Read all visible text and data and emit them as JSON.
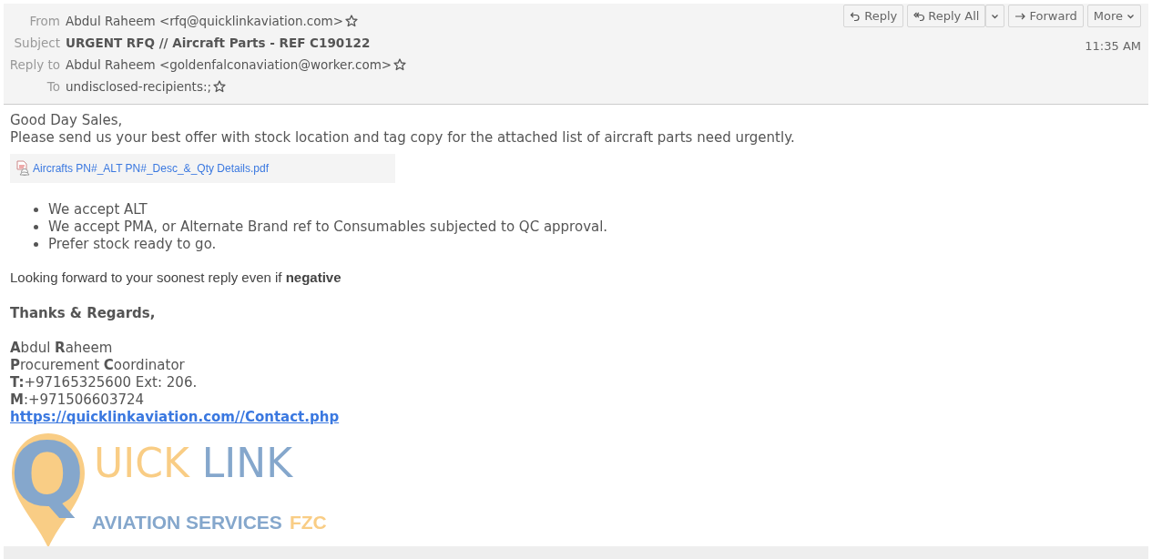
{
  "header": {
    "fields": [
      {
        "label": "From",
        "value": "Abdul Raheem <rfq@quicklinkaviation.com>",
        "kind": "address",
        "starred": false
      },
      {
        "label": "Subject",
        "value": "URGENT RFQ // Aircraft Parts - REF C190122",
        "kind": "subject"
      },
      {
        "label": "Reply to",
        "value": "Abdul Raheem <goldenfalconaviation@worker.com>",
        "kind": "address",
        "starred": false
      },
      {
        "label": "To",
        "value": "undisclosed-recipients:;",
        "kind": "address",
        "starred": false
      }
    ],
    "buttons": [
      {
        "label": "Reply",
        "kind": "reply"
      },
      {
        "label": "Reply All",
        "kind": "reply-all"
      },
      {
        "label": "Forward",
        "kind": "forward"
      },
      {
        "label": "More",
        "kind": "more"
      }
    ],
    "time": "11:35 AM"
  },
  "body": {
    "greeting": [
      "Good Day Sales,",
      "Please send us your best offer with stock location and tag copy for the attached list of aircraft parts need urgently."
    ],
    "attachment": "Aircrafts PN#_ALT PN#_Desc_&_Qty Details.pdf",
    "bullets": [
      "We accept ALT",
      "We accept PMA, or Alternate Brand ref to Consumables  subjected to QC approval.",
      "Prefer stock ready to go."
    ],
    "closing": "Looking forward to your soonest reply even if **negative**",
    "regards": "Thanks & Regards,",
    "signature": [
      "**A**bdul **R**aheem",
      "**P**rocurement **C**oordinator",
      "**T:**+97165325600 Ext: 206.",
      "**M**:+971506603724"
    ],
    "link": "https://quicklinkaviation.com//Contact.php",
    "logo": {
      "initial": "Q",
      "word1": "UICK",
      "word2": "LINK",
      "tagline": "AVIATION SERVICES",
      "tagline_suffix": "FZC"
    }
  }
}
